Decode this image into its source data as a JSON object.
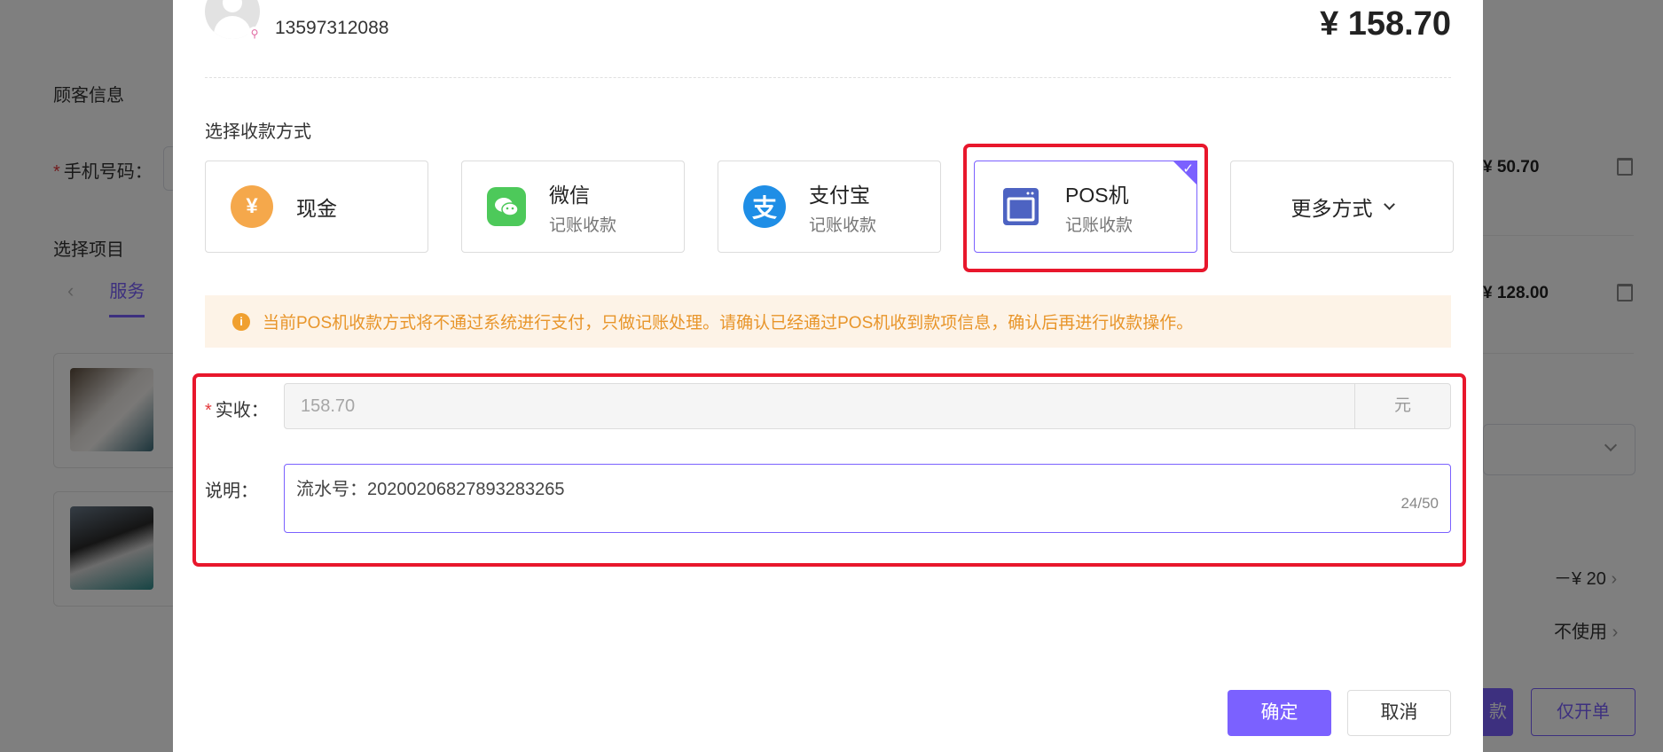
{
  "background": {
    "customer_info_title": "顾客信息",
    "phone_label": "手机号码：",
    "select_items_title": "选择项目",
    "tab_service": "服务",
    "item_prices": [
      "¥ 50.70",
      "¥ 128.00"
    ],
    "discount_value": "－¥ 20",
    "coupon_value": "不使用",
    "collect_btn_partial": "款",
    "open_order_btn": "仅开单"
  },
  "modal": {
    "customer_phone": "13597312088",
    "total_amount": "¥ 158.70",
    "payment_section_title": "选择收款方式",
    "payment_methods": [
      {
        "name": "现金",
        "sub": "",
        "icon": "yen-icon",
        "color": "#f5a84b"
      },
      {
        "name": "微信",
        "sub": "记账收款",
        "icon": "wechat-icon",
        "color": "#4dc95a"
      },
      {
        "name": "支付宝",
        "sub": "记账收款",
        "icon": "alipay-icon",
        "color": "#1f8ee6"
      },
      {
        "name": "POS机",
        "sub": "记账收款",
        "icon": "pos-terminal-icon",
        "color": "#4d63c2"
      }
    ],
    "selected_method": "POS机",
    "more_methods_label": "更多方式",
    "notice_text": "当前POS机收款方式将不通过系统进行支付，只做记账处理。请确认已经通过POS机收到款项信息，确认后再进行收款操作。",
    "amount_label": "实收：",
    "amount_value": "158.70",
    "amount_unit": "元",
    "note_label": "说明：",
    "note_value": "流水号：20200206827893283265",
    "note_counter": "24/50",
    "confirm_label": "确定",
    "cancel_label": "取消"
  },
  "colors": {
    "accent": "#7b61ff",
    "highlight_border": "#e8172c",
    "notice_bg": "#fdf3e7",
    "notice_text": "#e8952a"
  }
}
